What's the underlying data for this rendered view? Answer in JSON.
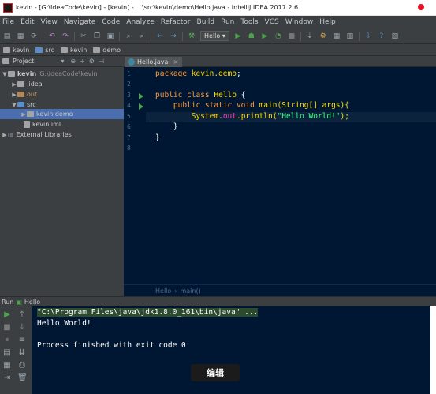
{
  "window": {
    "title": "kevin - [G:\\IdeaCode\\kevin] - [kevin] - ...\\src\\kevin\\demo\\Hello.java - IntelliJ IDEA 2017.2.6"
  },
  "menu": [
    "File",
    "Edit",
    "View",
    "Navigate",
    "Code",
    "Analyze",
    "Refactor",
    "Build",
    "Run",
    "Tools",
    "VCS",
    "Window",
    "Help"
  ],
  "toolbar": {
    "run_config": "Hello"
  },
  "breadcrumb": [
    "kevin",
    "src",
    "kevin",
    "demo"
  ],
  "project": {
    "header": "Project",
    "tree": [
      {
        "label": "kevin",
        "hint": "G:\\IdeaCode\\kevin"
      },
      {
        "label": ".idea"
      },
      {
        "label": "out"
      },
      {
        "label": "src"
      },
      {
        "label": "kevin.demo"
      },
      {
        "label": "kevin.iml"
      },
      {
        "label": "External Libraries"
      }
    ]
  },
  "editor": {
    "tab": "Hello.java",
    "line_numbers": [
      "1",
      "2",
      "3",
      "4",
      "5",
      "6",
      "7",
      "8"
    ],
    "code": {
      "l1_kw": "package ",
      "l1_pkg": "kevin.demo",
      "l1_end": ";",
      "l3_kw": "public class ",
      "l3_cls": "Hello",
      "l3_end": " {",
      "l4_kw": "    public static void ",
      "l4_fn": "main",
      "l4_par": "(String[] args){",
      "l5_cls": "        System",
      "l5_dot": ".",
      "l5_fld": "out",
      "l5_mid": ".println(",
      "l5_str": "\"Hello World!\"",
      "l5_end": ");",
      "l6": "    }",
      "l7": "}"
    },
    "crumbs": [
      "Hello",
      "main()"
    ]
  },
  "run": {
    "header_label": "Run",
    "config": "Hello",
    "console": [
      "\"C:\\Program Files\\java\\jdk1.8.0_161\\bin\\java\" ...",
      "Hello World!",
      "",
      "Process finished with exit code 0"
    ]
  },
  "overlay": {
    "edit_label": "编辑"
  },
  "colors": {
    "editor_bg": "#001733",
    "panel_bg": "#3c3f41",
    "selection": "#4b6eaf"
  }
}
